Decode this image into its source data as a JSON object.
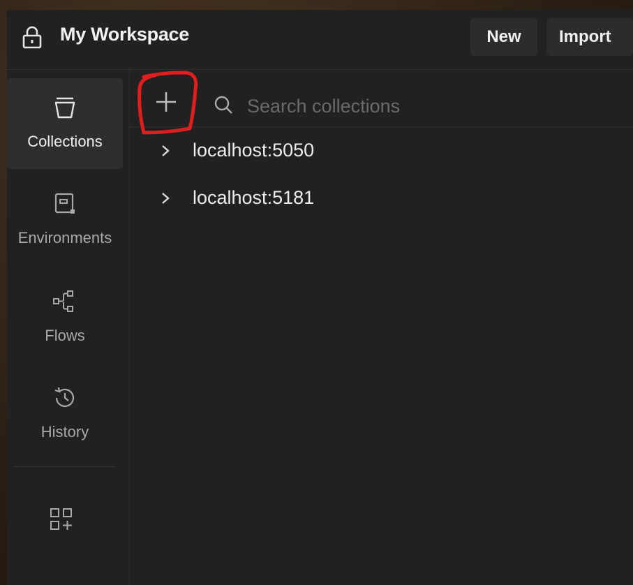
{
  "header": {
    "workspace_title": "My Workspace",
    "new_label": "New",
    "import_label": "Import",
    "lock_icon": "lock-icon"
  },
  "sidebar": {
    "items": [
      {
        "label": "Collections",
        "icon": "collections-icon",
        "active": true
      },
      {
        "label": "Environments",
        "icon": "environments-icon",
        "active": false
      },
      {
        "label": "Flows",
        "icon": "flows-icon",
        "active": false
      },
      {
        "label": "History",
        "icon": "history-icon",
        "active": false
      }
    ],
    "apps_icon": "apps-add-icon"
  },
  "toolbar": {
    "add_icon": "plus-icon",
    "search_placeholder": "Search collections",
    "search_value": ""
  },
  "collections": [
    {
      "name": "localhost:5050"
    },
    {
      "name": "localhost:5181"
    }
  ],
  "colors": {
    "background": "#212121",
    "annotation": "#e01e1e",
    "text": "#ededed",
    "muted": "#a9a9a9"
  }
}
